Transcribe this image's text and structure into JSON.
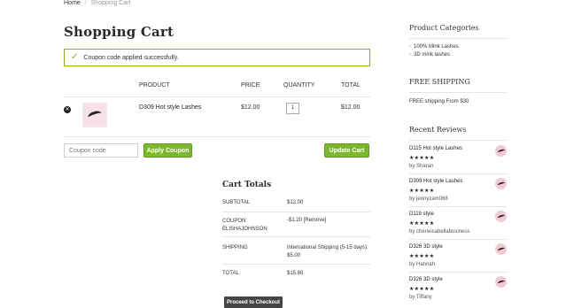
{
  "breadcrumb": {
    "home": "Home",
    "separator": "/",
    "current": "Shopping Cart"
  },
  "page": {
    "title": "Shopping Cart"
  },
  "notice": {
    "icon": "check-icon",
    "text": "Coupon code applied successfully."
  },
  "cart": {
    "headers": {
      "product": "PRODUCT",
      "price": "PRICE",
      "quantity": "QUANTITY",
      "total": "TOTAL"
    },
    "items": [
      {
        "name": "D309 Hot style Lashes",
        "price": "$12.00",
        "quantity": "1",
        "total": "$12.00"
      }
    ]
  },
  "actions": {
    "coupon_placeholder": "Coupon code",
    "apply_label": "Apply Coupon",
    "update_label": "Update Cart",
    "checkout_label": "Proceed to Checkout"
  },
  "totals": {
    "title": "Cart Totals",
    "subtotal_label": "SUBTOTAL",
    "subtotal_value": "$12.00",
    "coupon_label": "COUPON:",
    "coupon_code": "ELISHAJOHNSON",
    "coupon_value": "-$1.20",
    "coupon_remove": "[Remove]",
    "shipping_label": "SHIPPING",
    "shipping_method": "International Shipping (5-15 days):",
    "shipping_value": "$5.00",
    "total_label": "TOTAL",
    "total_value": "$15.80"
  },
  "sidebar": {
    "categories_title": "Product Categories",
    "categories": [
      "100% Mink Lashes",
      "3D mink lashes"
    ],
    "shipping_title": "FREE SHIPPING",
    "shipping_text": "FREE shipping From $30",
    "reviews_title": "Recent Reviews",
    "reviews": [
      {
        "product": "D115 Hot style Lashes",
        "stars": "★★★★★",
        "by": "by Sharan"
      },
      {
        "product": "D309 Hot style Lashes",
        "stars": "★★★★★",
        "by": "by jennyzam068"
      },
      {
        "product": "D119 style",
        "stars": "★★★★★",
        "by": "by cherieisabellabusiness"
      },
      {
        "product": "D326 3D style",
        "stars": "★★★★★",
        "by": "by Hannah"
      },
      {
        "product": "D326 3D style",
        "stars": "★★★★★",
        "by": "by Tiffany"
      }
    ]
  },
  "colors": {
    "accent_green": "#7cb82f",
    "notice_border": "#8fae1b",
    "checkout_bg": "#444444"
  }
}
